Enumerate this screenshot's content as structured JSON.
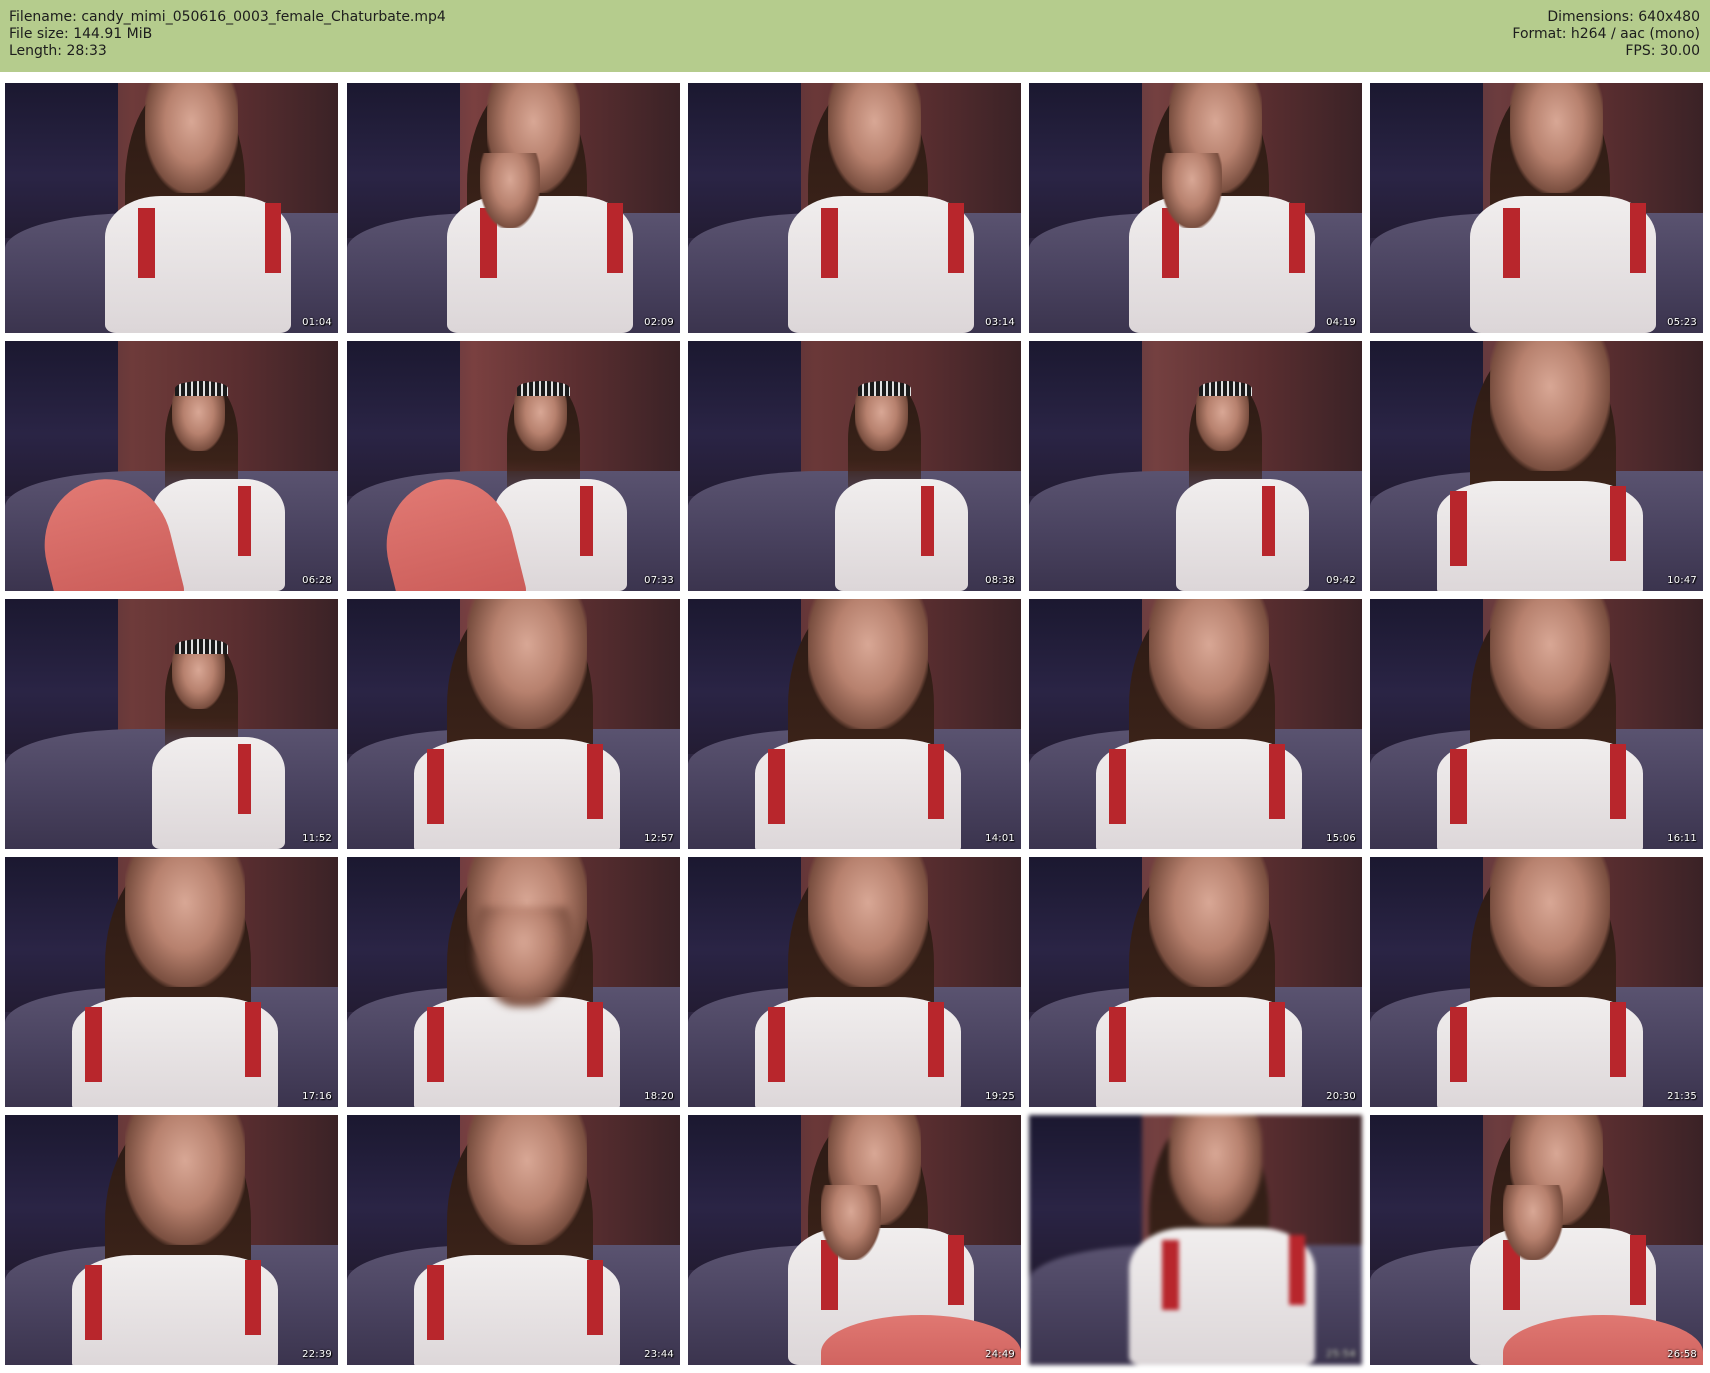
{
  "header": {
    "filename_label": "Filename:",
    "filename": "candy_mimi_050616_0003_female_Chaturbate.mp4",
    "filesize_label": "File size:",
    "filesize": "144.91 MiB",
    "length_label": "Length:",
    "length": "28:33",
    "dimensions_label": "Dimensions:",
    "dimensions": "640x480",
    "format_label": "Format:",
    "format": "h264 / aac (mono)",
    "fps_label": "FPS:",
    "fps": "30.00",
    "background_color": "#b5cc8d"
  },
  "thumbnails": [
    {
      "timestamp": "01:04",
      "pose": "sofa-closeup"
    },
    {
      "timestamp": "02:09",
      "pose": "smoking"
    },
    {
      "timestamp": "03:14",
      "pose": "sofa-closeup"
    },
    {
      "timestamp": "04:19",
      "pose": "smoking"
    },
    {
      "timestamp": "05:23",
      "pose": "sofa-closeup"
    },
    {
      "timestamp": "06:28",
      "pose": "reclined-legs"
    },
    {
      "timestamp": "07:33",
      "pose": "reclined-legs"
    },
    {
      "timestamp": "08:38",
      "pose": "reclined"
    },
    {
      "timestamp": "09:42",
      "pose": "reclined"
    },
    {
      "timestamp": "10:47",
      "pose": "face-closeup"
    },
    {
      "timestamp": "11:52",
      "pose": "reclined"
    },
    {
      "timestamp": "12:57",
      "pose": "face-closeup"
    },
    {
      "timestamp": "14:01",
      "pose": "face-closeup"
    },
    {
      "timestamp": "15:06",
      "pose": "face-closeup"
    },
    {
      "timestamp": "16:11",
      "pose": "face-closeup"
    },
    {
      "timestamp": "17:16",
      "pose": "face-closeup"
    },
    {
      "timestamp": "18:20",
      "pose": "blurred-hand"
    },
    {
      "timestamp": "19:25",
      "pose": "face-closeup"
    },
    {
      "timestamp": "20:30",
      "pose": "face-closeup"
    },
    {
      "timestamp": "21:35",
      "pose": "face-closeup"
    },
    {
      "timestamp": "22:39",
      "pose": "looking-down"
    },
    {
      "timestamp": "23:44",
      "pose": "face-closeup"
    },
    {
      "timestamp": "24:49",
      "pose": "smoking-legs"
    },
    {
      "timestamp": "25:54",
      "pose": "blurred"
    },
    {
      "timestamp": "26:58",
      "pose": "hand-face-legs"
    }
  ]
}
